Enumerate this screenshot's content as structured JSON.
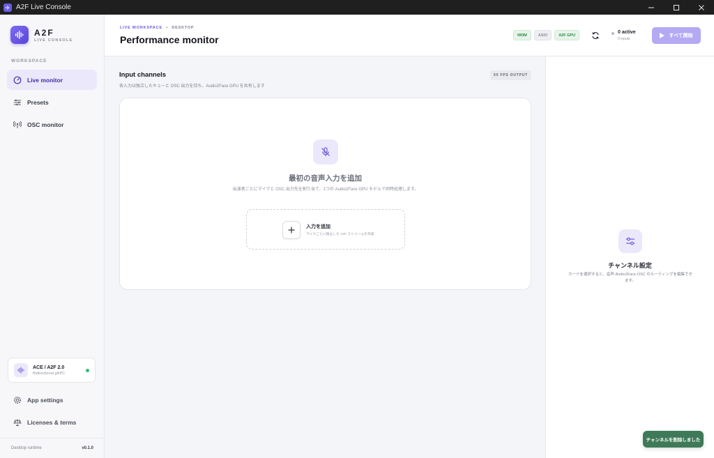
{
  "window": {
    "title": "A2F Live Console",
    "controls": [
      "minimize-icon",
      "maximize-icon",
      "close-icon"
    ]
  },
  "brand": {
    "name": "A2F",
    "subtitle": "LIVE CONSOLE",
    "accent": "#6d5ce8"
  },
  "sidebar": {
    "section_label": "WORKSPACE",
    "items": [
      {
        "label": "Live monitor",
        "icon": "gauge-icon",
        "active": true
      },
      {
        "label": "Presets",
        "icon": "sliders-icon",
        "active": false
      },
      {
        "label": "OSC monitor",
        "icon": "broadcast-icon",
        "active": false
      }
    ],
    "runtime_card": {
      "title": "ACE / A2F 2.0",
      "subtitle": "Bidirectional gRPC",
      "status_color": "#3bb873"
    },
    "bottom_items": [
      {
        "label": "App settings",
        "icon": "gear-icon"
      },
      {
        "label": "Licenses & terms",
        "icon": "scale-icon"
      }
    ],
    "footer": {
      "label": "Desktop runtime",
      "version": "v0.1.0"
    }
  },
  "header": {
    "breadcrumb": {
      "first": "LIVE WORKSPACE",
      "separator": "•",
      "second": "DESKTOP"
    },
    "title": "Performance monitor",
    "badges": [
      {
        "label": "WDM",
        "state": "on"
      },
      {
        "label": "ASIO",
        "state": "off"
      },
      {
        "label": "A2F GPU",
        "state": "on"
      }
    ],
    "active_count": "0 active",
    "inputs_count": "0 inputs",
    "start_all_label": "すべて開始"
  },
  "main": {
    "section_title": "Input channels",
    "section_subtitle": "各入力は独立したキューと OSC 出力を持ち、Audio2Face GPU を共有します",
    "fps_badge": "50 FPS OUTPUT",
    "empty": {
      "title": "最初の音声入力を追加",
      "subtitle": "出演者ごとにマイクと OSC 出力先を割り当て、1つの Audio2Face GPU モデルで同時処理します。",
      "add_title": "入力を追加",
      "add_subtitle": "マイクごとに独立した A2F ストリームを作成"
    }
  },
  "right_panel": {
    "title": "チャンネル設定",
    "subtitle": "カードを選択すると、音声‑Audio2Face‑OSC のルーティングを編集できます。"
  },
  "toast": {
    "message": "チャンネルを削除しました",
    "color": "#3f7a58"
  }
}
